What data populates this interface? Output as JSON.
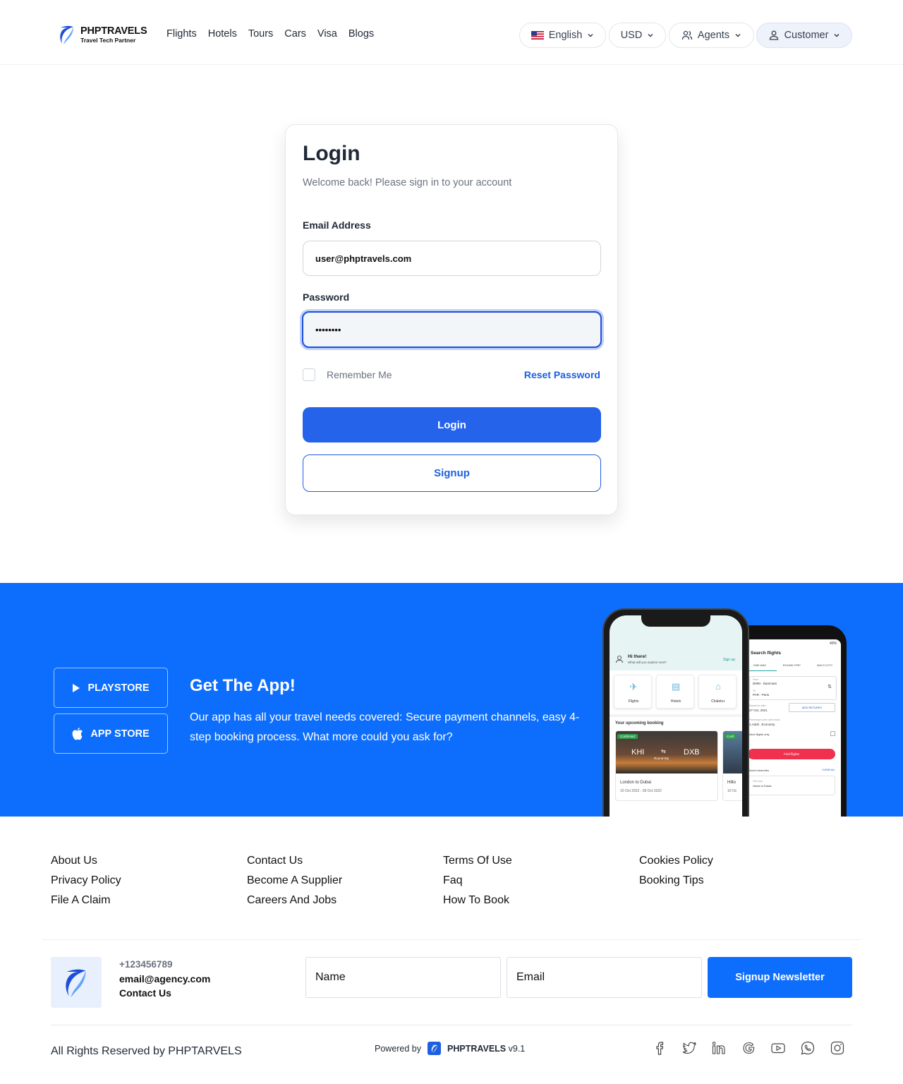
{
  "header": {
    "brand_name": "PHPTRAVELS",
    "brand_tagline": "Travel Tech Partner",
    "nav": [
      "Flights",
      "Hotels",
      "Tours",
      "Cars",
      "Visa",
      "Blogs"
    ],
    "language": "English",
    "currency": "USD",
    "agents": "Agents",
    "customer": "Customer"
  },
  "login": {
    "title": "Login",
    "subtitle": "Welcome back! Please sign in to your account",
    "email_label": "Email Address",
    "email_value": "user@phptravels.com",
    "password_label": "Password",
    "password_value": "••••••••",
    "remember_label": "Remember Me",
    "reset_label": "Reset Password",
    "login_button": "Login",
    "signup_button": "Signup"
  },
  "app_banner": {
    "playstore": "PLAYSTORE",
    "appstore": "APP STORE",
    "title": "Get The App!",
    "description": "Our app has all your travel needs covered: Secure payment channels, easy 4-step booking process. What more could you ask for?",
    "phone_front": {
      "greeting": "Hi there!",
      "question": "What will you explore next?",
      "signup": "Sign up",
      "tiles": [
        "Flights",
        "Hotels",
        "Chalets+"
      ],
      "upcoming": "Your upcoming booking",
      "badge": "Confirmed",
      "from": "KHI",
      "to": "DXB",
      "trip": "Round-trip",
      "route": "London to Dubai",
      "dates": "10 Oct 2022 - 28 Oct 2022",
      "peek_badge": "Confi",
      "peek_title": "Hilto",
      "peek_date": "10 Oc"
    },
    "phone_back": {
      "status": "40%",
      "title": "Search flights",
      "tabs": [
        "ONE-WAY",
        "ROUND-TRIP",
        "MULTI-CITY"
      ],
      "from_label": "From",
      "from_value": "DMM - Dammam",
      "to_label": "To",
      "to_value": "PAR - Paris",
      "dep_label": "Departure date",
      "dep_value": "27 Oct, 2021",
      "add_return": "ADD RETURN?",
      "pax_label": "Passengers and cabin class",
      "pax_value": "1 Adult , Economy",
      "direct": "Direct flights only",
      "find": "Find flights",
      "recent": "Recent searches",
      "clear": "CLEAR ALL",
      "recent_type": "One way",
      "recent_route": "Varna to Dubai"
    }
  },
  "footer": {
    "columns": [
      [
        "About Us",
        "Privacy Policy",
        "File A Claim"
      ],
      [
        "Contact Us",
        "Become A Supplier",
        "Careers And Jobs"
      ],
      [
        "Terms Of Use",
        "Faq",
        "How To Book"
      ],
      [
        "Cookies Policy",
        "Booking Tips"
      ]
    ],
    "phone": "+123456789",
    "email": "email@agency.com",
    "contact": "Contact Us",
    "newsletter_name_placeholder": "Name",
    "newsletter_email_placeholder": "Email",
    "newsletter_button": "Signup Newsletter",
    "rights": "All Rights Reserved by PHPTARVELS",
    "powered_by": "Powered by",
    "powered_brand": "PHPTRAVELS",
    "version": "v9.1",
    "social_icons": [
      "facebook-icon",
      "twitter-icon",
      "linkedin-icon",
      "google-icon",
      "youtube-icon",
      "whatsapp-icon",
      "instagram-icon"
    ]
  },
  "colors": {
    "primary": "#2563eb",
    "banner": "#0d6efd",
    "link": "#1d5fe0"
  }
}
